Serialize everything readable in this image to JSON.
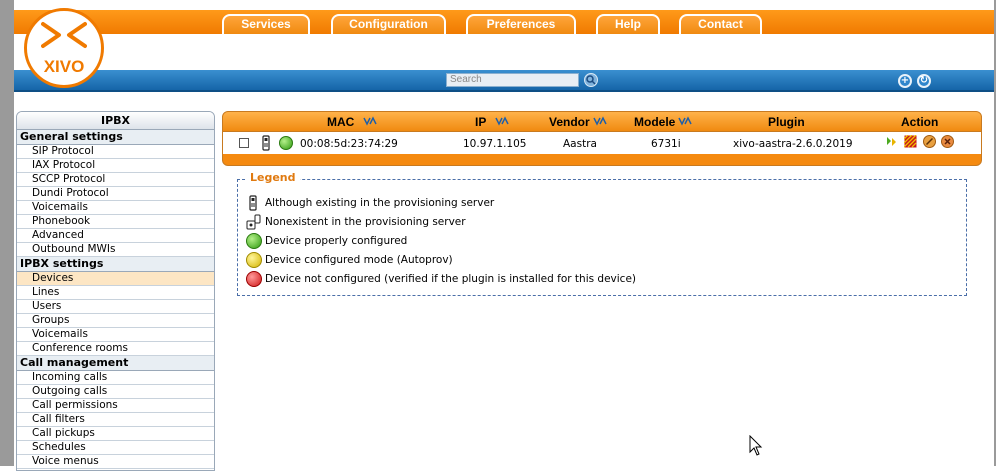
{
  "logo": {
    "text": "XIVO"
  },
  "nav": {
    "tabs": [
      "Services",
      "Configuration",
      "Preferences",
      "Help",
      "Contact"
    ]
  },
  "search": {
    "placeholder": "Search"
  },
  "sidebar": {
    "title": "IPBX",
    "sections": [
      {
        "heading": "General settings",
        "items": [
          "SIP Protocol",
          "IAX Protocol",
          "SCCP Protocol",
          "Dundi Protocol",
          "Voicemails",
          "Phonebook",
          "Advanced",
          "Outbound MWIs"
        ]
      },
      {
        "heading": "IPBX settings",
        "items": [
          "Devices",
          "Lines",
          "Users",
          "Groups",
          "Voicemails",
          "Conference rooms"
        ]
      },
      {
        "heading": "Call management",
        "items": [
          "Incoming calls",
          "Outgoing calls",
          "Call permissions",
          "Call filters",
          "Call pickups",
          "Schedules",
          "Voice menus"
        ]
      }
    ],
    "active_item": "Devices"
  },
  "table": {
    "columns": [
      "MAC",
      "IP",
      "Vendor",
      "Modele",
      "Plugin",
      "Action"
    ],
    "rows": [
      {
        "mac": "00:08:5d:23:74:29",
        "ip": "10.97.1.105",
        "vendor": "Aastra",
        "model": "6731i",
        "plugin": "xivo-aastra-2.6.0.2019",
        "status": "green"
      }
    ]
  },
  "legend": {
    "title": "Legend",
    "items": [
      {
        "icon": "phone-exists-icon",
        "text": "Although existing in the provisioning server"
      },
      {
        "icon": "phone-nonexistent-icon",
        "text": "Nonexistent in the provisioning server"
      },
      {
        "icon": "green-dot",
        "text": "Device properly configured"
      },
      {
        "icon": "yellow-dot",
        "text": "Device configured mode (Autoprov)"
      },
      {
        "icon": "red-dot",
        "text": "Device not configured (verified if the plugin is installed for this device)"
      }
    ]
  },
  "colors": {
    "accent": "#f08a10",
    "nav_blue": "#1f74b8",
    "legend_border": "#4a6ea8"
  }
}
